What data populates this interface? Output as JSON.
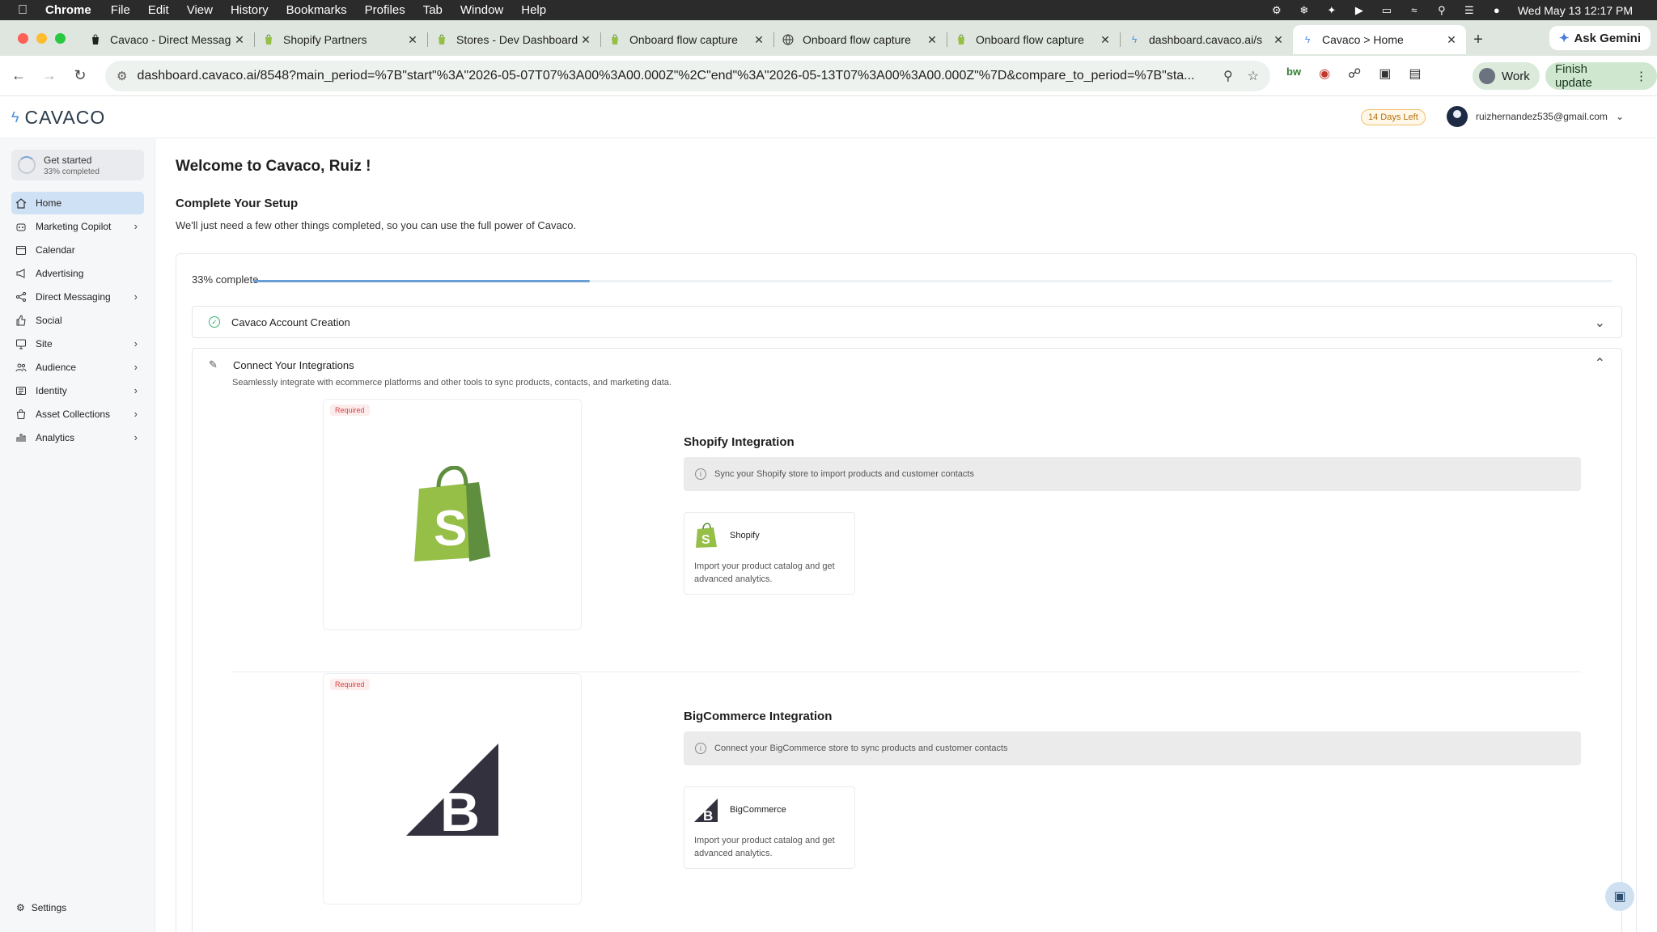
{
  "menubar": {
    "items": [
      "Chrome",
      "File",
      "Edit",
      "View",
      "History",
      "Bookmarks",
      "Profiles",
      "Tab",
      "Window",
      "Help"
    ],
    "clock": "Wed May 13  12:17 PM"
  },
  "tabs": [
    {
      "title": "Cavaco - Direct Messag",
      "icon": "shopify-bag-icon"
    },
    {
      "title": "Shopify Partners",
      "icon": "shopify-bag-icon"
    },
    {
      "title": "Stores - Dev Dashboard",
      "icon": "shopify-bag-icon"
    },
    {
      "title": "Onboard flow capture",
      "icon": "shopify-bag-icon"
    },
    {
      "title": "Onboard flow capture",
      "icon": "globe-icon"
    },
    {
      "title": "Onboard flow capture",
      "icon": "shopify-bag-icon"
    },
    {
      "title": "dashboard.cavaco.ai/s",
      "icon": "cavaco-icon"
    },
    {
      "title": "Cavaco > Home",
      "icon": "cavaco-icon"
    }
  ],
  "gemini": {
    "label": "Ask Gemini"
  },
  "omnibox": {
    "url": "dashboard.cavaco.ai/8548?main_period=%7B\"start\"%3A\"2026-05-07T07%3A00%3A00.000Z\"%2C\"end\"%3A\"2026-05-13T07%3A00%3A00.000Z\"%7D&compare_to_period=%7B\"sta..."
  },
  "profile": {
    "label": "Work"
  },
  "finish_update": {
    "label": "Finish update"
  },
  "app": {
    "logo": "CAVACO",
    "trial_badge": "14 Days Left",
    "user_email": "ruizhernandez535@gmail.com"
  },
  "sidebar": {
    "get_started": {
      "title": "Get started",
      "subtitle": "33% completed"
    },
    "items": [
      {
        "label": "Home",
        "icon": "home-icon",
        "has_children": false
      },
      {
        "label": "Marketing Copilot",
        "icon": "robot-icon",
        "has_children": true
      },
      {
        "label": "Calendar",
        "icon": "calendar-icon",
        "has_children": false
      },
      {
        "label": "Advertising",
        "icon": "megaphone-icon",
        "has_children": false
      },
      {
        "label": "Direct Messaging",
        "icon": "share-icon",
        "has_children": true
      },
      {
        "label": "Social",
        "icon": "thumbs-up-icon",
        "has_children": false
      },
      {
        "label": "Site",
        "icon": "monitor-icon",
        "has_children": true
      },
      {
        "label": "Audience",
        "icon": "users-icon",
        "has_children": true
      },
      {
        "label": "Identity",
        "icon": "id-card-icon",
        "has_children": true
      },
      {
        "label": "Asset Collections",
        "icon": "bag-icon",
        "has_children": true
      },
      {
        "label": "Analytics",
        "icon": "bar-chart-icon",
        "has_children": true
      }
    ],
    "settings": "Settings"
  },
  "main": {
    "welcome": "Welcome to Cavaco, Ruiz !",
    "setup_title": "Complete Your Setup",
    "setup_subtitle": "We'll just need a few other things completed, so you can use the full power of Cavaco.",
    "progress": {
      "label": "33% complete",
      "percent": 33
    },
    "account_creation": {
      "label": "Cavaco Account Creation"
    },
    "integrations": {
      "title": "Connect Your Integrations",
      "subtitle": "Seamlessly integrate with ecommerce platforms and other tools to sync products, contacts, and marketing data.",
      "items": [
        {
          "badge": "Required",
          "title": "Shopify Integration",
          "info": "Sync your Shopify store to import products and customer contacts",
          "tile_name": "Shopify",
          "tile_desc": "Import your product catalog and get advanced analytics."
        },
        {
          "badge": "Required",
          "title": "BigCommerce Integration",
          "info": "Connect your BigCommerce store to sync products and customer contacts",
          "tile_name": "BigCommerce",
          "tile_desc": "Import your product catalog and get advanced analytics."
        }
      ]
    }
  },
  "colors": {
    "accent": "#6a9fd6",
    "active_nav": "#cfe1f4",
    "shopify_green": "#95bf47",
    "bigcommerce_dark": "#34313f"
  }
}
